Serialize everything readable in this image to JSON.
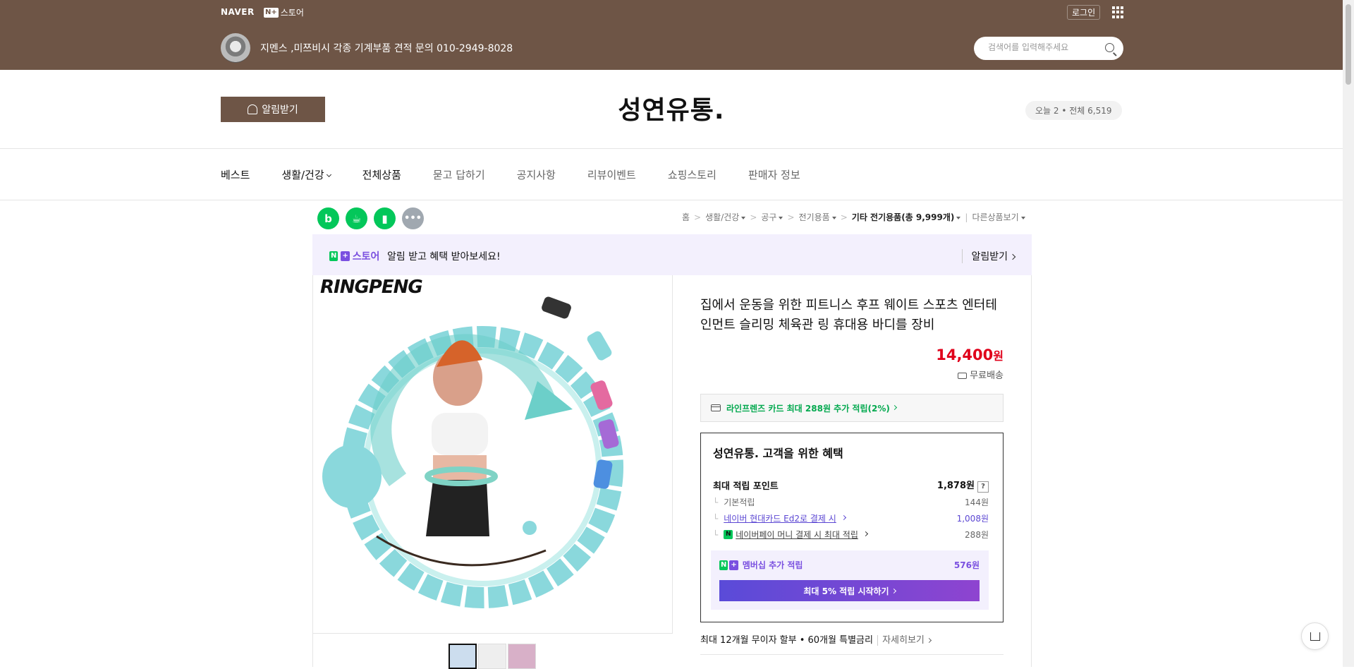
{
  "topbar": {
    "naver": "NAVER",
    "np_badge": "N+",
    "np_label": "스토어",
    "login": "로그인",
    "store_name": "지멘스 ,미쯔비시 각종 기계부품 견적 문의 010-2949-8028",
    "search_placeholder": "검색어를 입력해주세요"
  },
  "header": {
    "alert_button": "알림받기",
    "brand": "성연유통.",
    "visitor": "오늘 2 • 전체 6,519"
  },
  "nav": {
    "items": [
      {
        "label": "베스트",
        "tone": "dark"
      },
      {
        "label": "생활/건강",
        "tone": "dark"
      },
      {
        "label": "전체상품",
        "tone": "dark"
      },
      {
        "label": "묻고 답하기",
        "tone": "light"
      },
      {
        "label": "공지사항",
        "tone": "light"
      },
      {
        "label": "리뷰이벤트",
        "tone": "light"
      },
      {
        "label": "쇼핑스토리",
        "tone": "light"
      },
      {
        "label": "판매자 정보",
        "tone": "light"
      }
    ]
  },
  "share_icons": [
    "blog-icon",
    "cafe-icon",
    "bookmark-icon",
    "more-icon"
  ],
  "breadcrumb": {
    "items": [
      "홈",
      "생활/건강",
      "공구",
      "전기용품"
    ],
    "current": "기타 전기용품(총 9,999개)",
    "other": "다른상품보기"
  },
  "banner": {
    "badge_n": "N",
    "badge_plus": "+",
    "badge_label": "스토어",
    "message": "알림 받고 혜택 받아보세요!",
    "cta": "알림받기"
  },
  "product": {
    "image_logo": "RINGPENG",
    "title": "집에서 운동을 위한 피트니스 후프 웨이트 스포츠 엔터테인먼트 슬리밍 체육관 링 휴대용 바디를 장비",
    "price": "14,400",
    "price_unit": "원",
    "shipping": "무료배송",
    "card_benefit": "라인프렌즈 카드 최대 288원 추가 적립(2%)",
    "benefit_title": "성연유통. 고객을 위한 혜택",
    "max_points_label": "최대 적립 포인트",
    "max_points_value": "1,878원",
    "basic_label": "기본적립",
    "basic_value": "144원",
    "card_label": "네이버 현대카드 Ed2로 결제 시",
    "card_value": "1,008원",
    "npay_label": "네이버페이 머니 결제 시 최대 적립",
    "npay_value": "288원",
    "member_label": "멤버십 추가 적립",
    "member_value": "576원",
    "member_button": "최대 5% 적립 시작하기",
    "installment": "최대 12개월 무이자 할부 • 60개월 특별금리",
    "installment_more": "자세히보기"
  },
  "colors": {
    "brand_brown": "#6e5546",
    "naver_green": "#03c75a",
    "price_red": "#e0001a",
    "purple": "#7a50e0"
  }
}
